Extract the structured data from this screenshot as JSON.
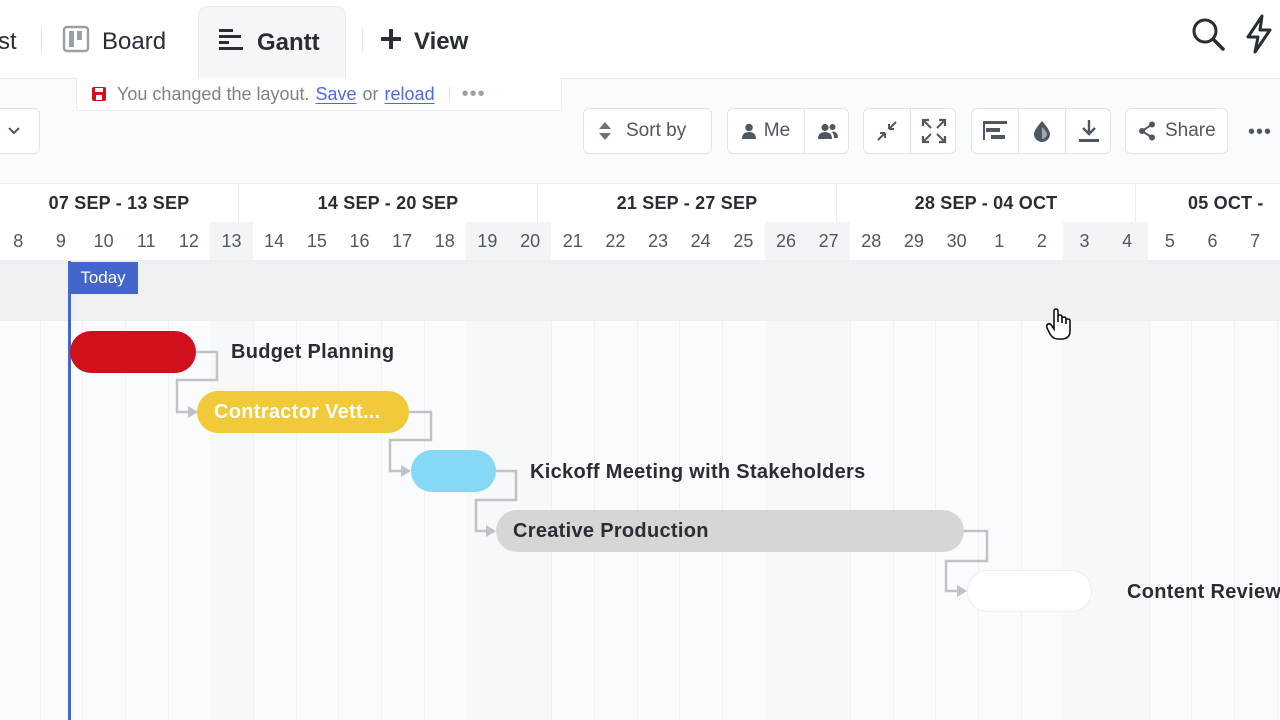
{
  "tabs": [
    {
      "label": "st",
      "icon": "list-icon"
    },
    {
      "label": "Board",
      "icon": "board-icon"
    },
    {
      "label": "Gantt",
      "icon": "gantt-icon",
      "active": true
    },
    {
      "label": "View",
      "icon": "plus-icon"
    }
  ],
  "notice": {
    "text": "You changed the layout.",
    "save": "Save",
    "or": "or",
    "reload": "reload"
  },
  "toolbar": {
    "sort_label": "Sort by",
    "me_label": "Me",
    "share_label": "Share"
  },
  "weeks": [
    "07 SEP - 13 SEP",
    "14 SEP - 20 SEP",
    "21 SEP - 27 SEP",
    "28 SEP - 04 OCT",
    "05 OCT -"
  ],
  "days": [
    "8",
    "9",
    "10",
    "11",
    "12",
    "13",
    "14",
    "15",
    "16",
    "17",
    "18",
    "19",
    "20",
    "21",
    "22",
    "23",
    "24",
    "25",
    "26",
    "27",
    "28",
    "29",
    "30",
    "1",
    "2",
    "3",
    "4",
    "5",
    "6",
    "7"
  ],
  "today_label": "Today",
  "tasks": [
    {
      "name": "Budget Planning",
      "color": "#d0111b"
    },
    {
      "name": "Contractor Vett...",
      "color": "#f0ca39"
    },
    {
      "name": "Kickoff Meeting with Stakeholders",
      "color": "#86d8f7"
    },
    {
      "name": "Creative Production",
      "color": "#d6d6d6"
    },
    {
      "name": "Content Review",
      "color": "#ffffff"
    }
  ],
  "colors": {
    "accent": "#4466cc",
    "link": "#4a6bd8",
    "save_icon": "#d0111b"
  }
}
